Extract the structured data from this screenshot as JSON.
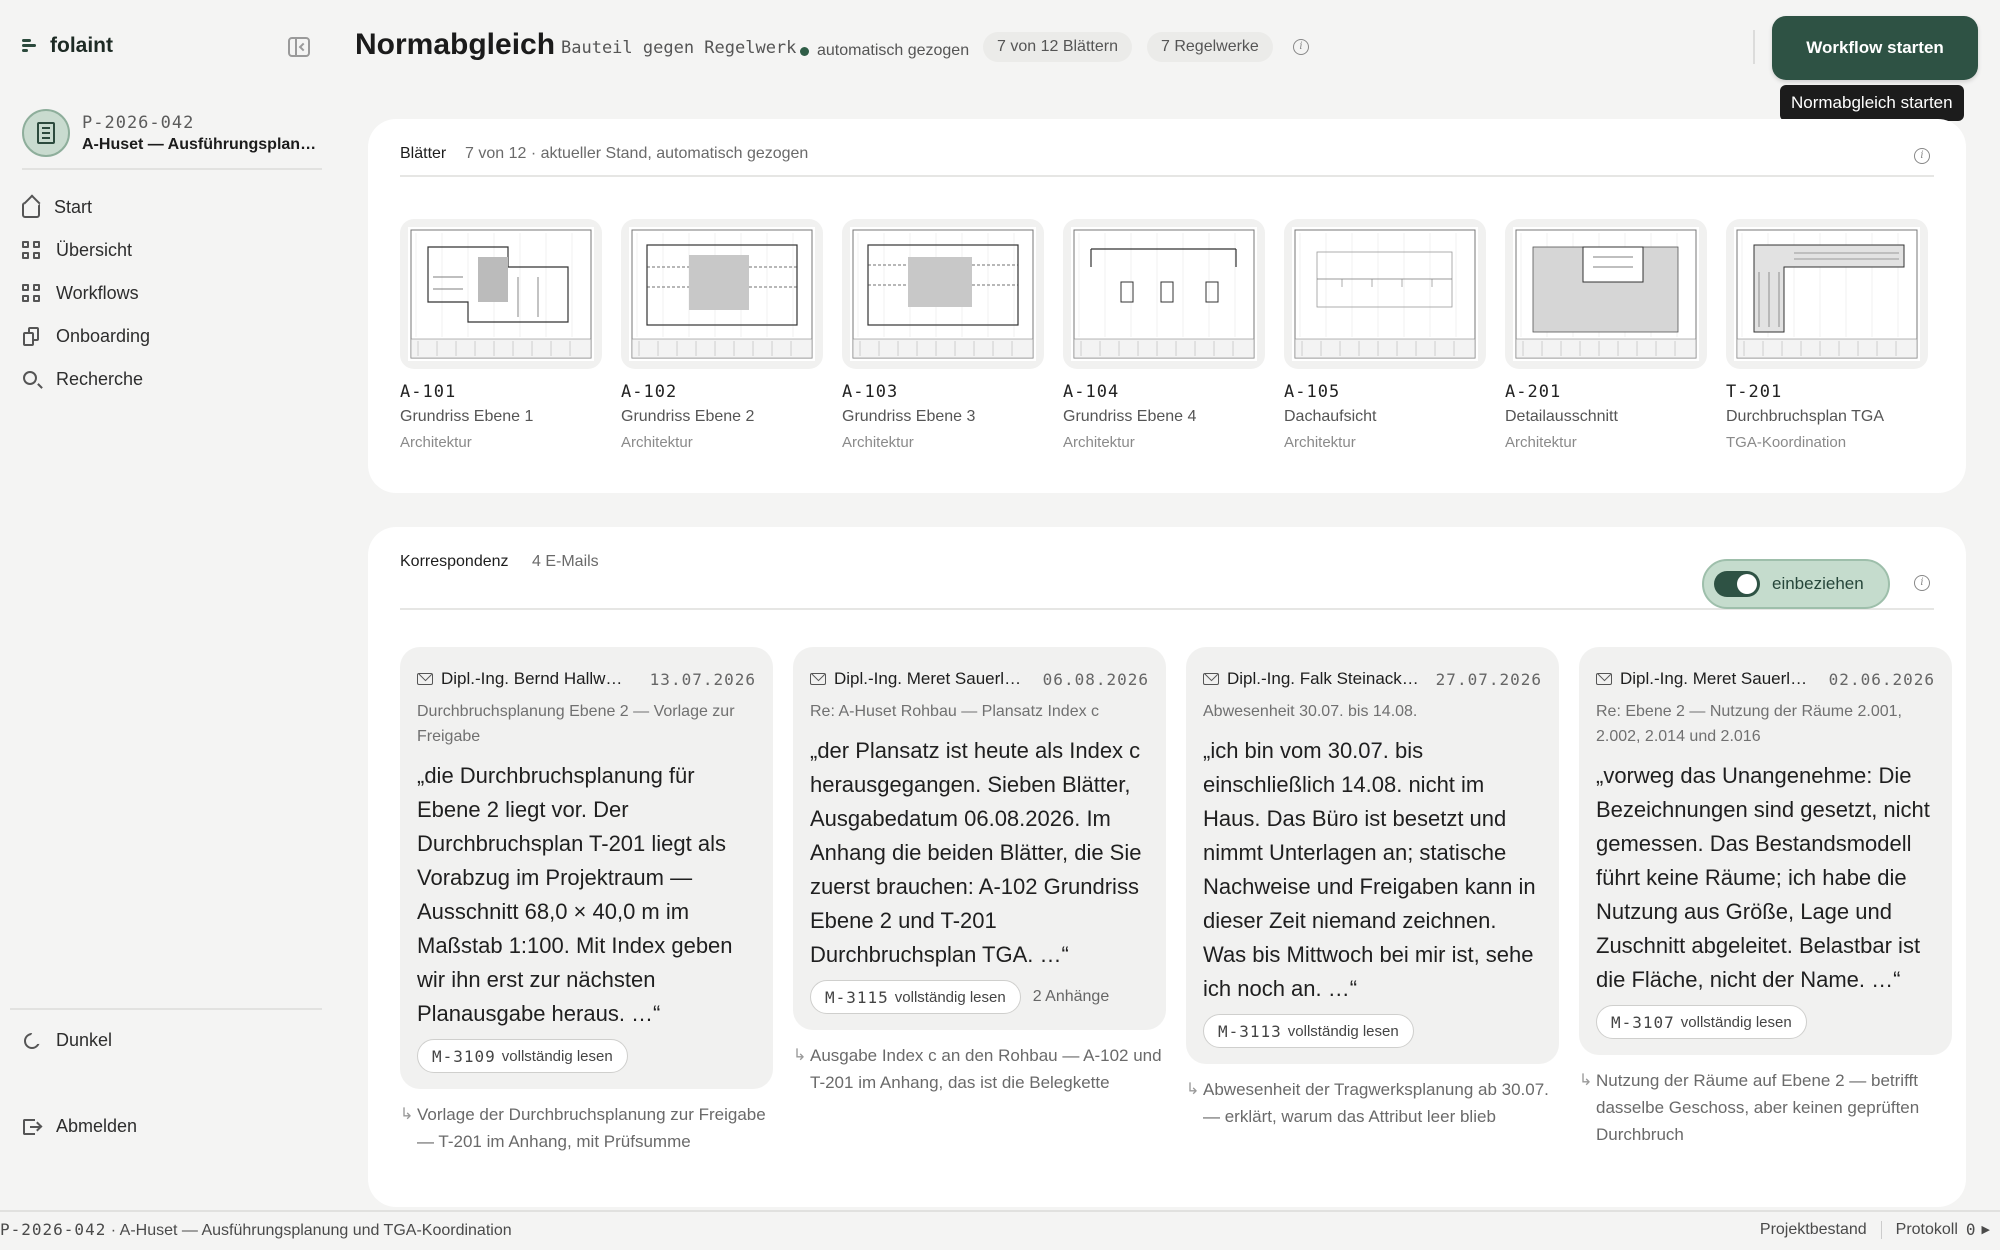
{
  "brand": {
    "name": "folaint"
  },
  "project": {
    "id": "P-2026-042",
    "name": "A-Huset — Ausführungsplan…"
  },
  "nav": [
    {
      "label": "Start",
      "icon": "home-icon"
    },
    {
      "label": "Übersicht",
      "icon": "grid-icon"
    },
    {
      "label": "Workflows",
      "icon": "grid-icon"
    },
    {
      "label": "Onboarding",
      "icon": "documents-icon"
    },
    {
      "label": "Recherche",
      "icon": "search-icon"
    }
  ],
  "nav_bottom": {
    "theme_label": "Dunkel",
    "logout_label": "Abmelden"
  },
  "header": {
    "title": "Normabgleich",
    "subtitle": "Bauteil gegen Regelwerk",
    "status": "automatisch gezogen",
    "chip_sheets": "7 von 12 Blättern",
    "chip_rules": "7 Regelwerke",
    "primary_button": "Workflow starten",
    "tooltip": "Normabgleich starten"
  },
  "sheets_card": {
    "title": "Blätter",
    "meta": "7 von 12 · aktueller Stand, automatisch gezogen",
    "items": [
      {
        "code": "A-101",
        "title": "Grundriss Ebene 1",
        "discipline": "Architektur"
      },
      {
        "code": "A-102",
        "title": "Grundriss Ebene 2",
        "discipline": "Architektur"
      },
      {
        "code": "A-103",
        "title": "Grundriss Ebene 3",
        "discipline": "Architektur"
      },
      {
        "code": "A-104",
        "title": "Grundriss Ebene 4",
        "discipline": "Architektur"
      },
      {
        "code": "A-105",
        "title": "Dachaufsicht",
        "discipline": "Architektur"
      },
      {
        "code": "A-201",
        "title": "Detailausschnitt",
        "discipline": "Architektur"
      },
      {
        "code": "T-201",
        "title": "Durchbruchsplan TGA",
        "discipline": "TGA-Koordination"
      }
    ]
  },
  "mail_card": {
    "title": "Korrespondenz",
    "meta": "4 E-Mails",
    "toggle_label": "einbeziehen",
    "read_label": "vollständig lesen",
    "items": [
      {
        "from": "Dipl.-Ing. Bernd Hallw…",
        "date": "13.07.2026",
        "subject": "Durchbruchsplanung Ebene 2 — Vorlage zur Freigabe",
        "quote": "„die Durchbruchsplanung für Ebene 2 liegt vor. Der Durchbruchsplan T-201 liegt als Vorabzug im Projektraum — Ausschnitt 68,0 × 40,0 m im Maßstab 1:100. Mit Index geben wir ihn erst zur nächsten Planausgabe heraus. …“",
        "ref": "M-3109",
        "attachments": "",
        "note": "Vorlage der Durchbruchsplanung zur Freigabe — T-201 im Anhang, mit Prüfsumme"
      },
      {
        "from": "Dipl.-Ing. Meret Sauerl…",
        "date": "06.08.2026",
        "subject": "Re: A-Huset Rohbau — Plansatz Index c",
        "quote": "„der Plansatz ist heute als Index c herausgegangen. Sieben Blätter, Ausgabedatum 06.08.2026. Im Anhang die beiden Blätter, die Sie zuerst brauchen: A-102 Grundriss Ebene 2 und T-201 Durchbruchsplan TGA. …“",
        "ref": "M-3115",
        "attachments": "2 Anhänge",
        "note": "Ausgabe Index c an den Rohbau — A-102 und T-201 im Anhang, das ist die Belegkette"
      },
      {
        "from": "Dipl.-Ing. Falk Steinack…",
        "date": "27.07.2026",
        "subject": "Abwesenheit 30.07. bis 14.08.",
        "quote": "„ich bin vom 30.07. bis einschließlich 14.08. nicht im Haus. Das Büro ist besetzt und nimmt Unterlagen an; statische Nachweise und Freigaben kann in dieser Zeit niemand zeichnen. Was bis Mittwoch bei mir ist, sehe ich noch an. …“",
        "ref": "M-3113",
        "attachments": "",
        "note": "Abwesenheit der Tragwerksplanung ab 30.07. — erklärt, warum das Attribut leer blieb"
      },
      {
        "from": "Dipl.-Ing. Meret Sauerl…",
        "date": "02.06.2026",
        "subject": "Re: Ebene 2 — Nutzung der Räume 2.001, 2.002, 2.014 und 2.016",
        "quote": "„vorweg das Unangenehme: Die Bezeichnungen sind gesetzt, nicht gemessen. Das Bestandsmodell führt keine Räume; ich habe die Nutzung aus Größe, Lage und Zuschnitt abgeleitet. Belastbar ist die Fläche, nicht der Name. …“",
        "ref": "M-3107",
        "attachments": "",
        "note": "Nutzung der Räume auf Ebene 2 — betrifft dasselbe Geschoss, aber keinen geprüften Durchbruch"
      }
    ]
  },
  "footer": {
    "project_id": "P-2026-042",
    "project_name": "· A-Huset — Ausführungsplanung und TGA-Koordination",
    "inventory_label": "Projektbestand",
    "log_label": "Protokoll",
    "log_count": "0"
  },
  "colors": {
    "accent": "#2e5244",
    "toggle_bg": "#c5dccd",
    "page_bg": "#f4f4f3"
  }
}
